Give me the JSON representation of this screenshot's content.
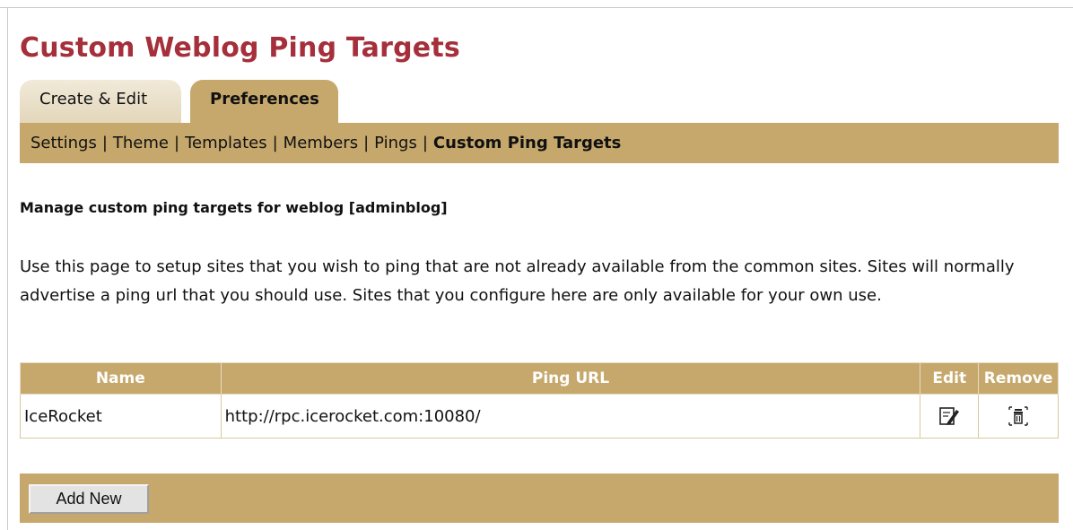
{
  "page": {
    "title": "Custom Weblog Ping Targets"
  },
  "tabs": [
    {
      "label": "Create & Edit",
      "active": false
    },
    {
      "label": "Preferences",
      "active": true
    }
  ],
  "subnav": {
    "items": [
      "Settings",
      "Theme",
      "Templates",
      "Members",
      "Pings"
    ],
    "separator": "|",
    "current": "Custom Ping Targets"
  },
  "content": {
    "heading": "Manage custom ping targets for weblog [adminblog]",
    "description": "Use this page to setup sites that you wish to ping that are not already available from the common sites. Sites will normally advertise a ping url that you should use. Sites that you configure here are only available for your own use."
  },
  "table": {
    "headers": {
      "name": "Name",
      "url": "Ping URL",
      "edit": "Edit",
      "remove": "Remove"
    },
    "rows": [
      {
        "name": "IceRocket",
        "url": "http://rpc.icerocket.com:10080/",
        "edit_icon": "edit-icon",
        "remove_icon": "trash-icon"
      }
    ]
  },
  "actions": {
    "add_label": "Add New"
  },
  "colors": {
    "accent": "#c6a86c",
    "title": "#a52f3a"
  }
}
